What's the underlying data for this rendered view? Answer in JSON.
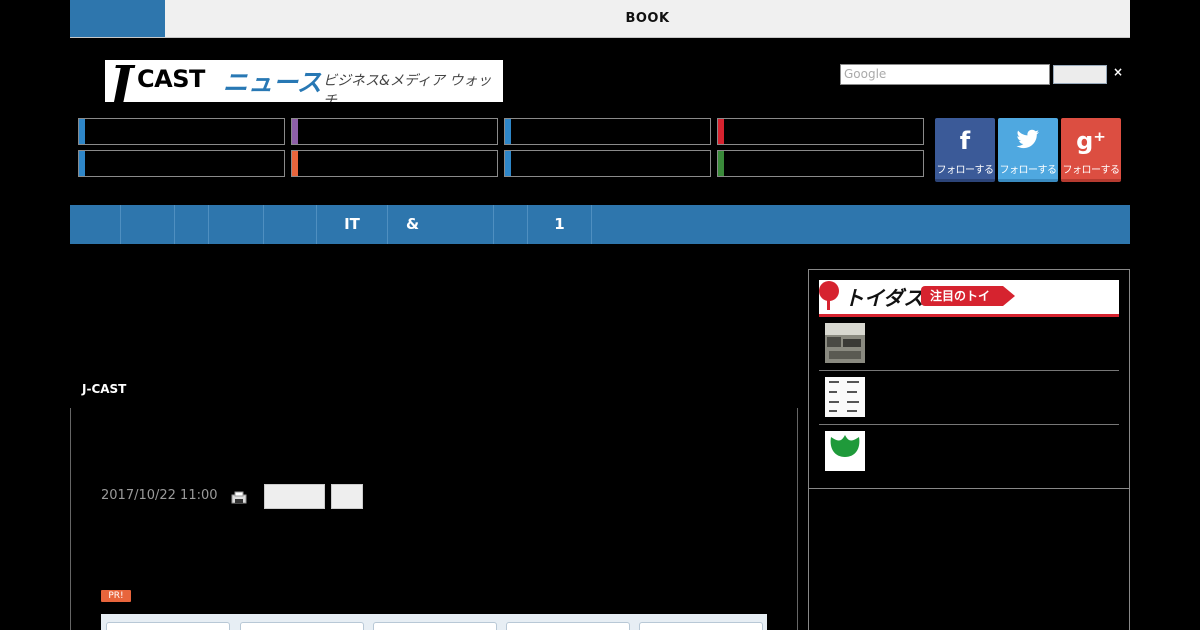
{
  "topbar": {
    "label": "BOOK"
  },
  "search": {
    "placeholder": "Google",
    "close_glyph": "×"
  },
  "social": {
    "facebook": {
      "icon": "f",
      "label": "フォローする"
    },
    "twitter": {
      "icon": "🐦",
      "label": "フォローする"
    },
    "googleplus": {
      "icon": "g⁺",
      "label": "フォローする"
    }
  },
  "category_colors": [
    "#2e86c8",
    "#8e5fa8",
    "#2e86c8",
    "#d6232f",
    "#2e86c8",
    "#e8653c",
    "#2e86c8",
    "#3a8a3a"
  ],
  "nav": {
    "items": [
      "",
      "",
      "",
      "",
      "IT",
      "&",
      "",
      "1"
    ]
  },
  "article": {
    "breadcrumb": "J-CAST",
    "date": "2017/10/22 11:00",
    "pr_label": "PR!"
  },
  "sidebar": {
    "banner_brand": "トイダス",
    "banner_pill": "注目のトイ"
  }
}
